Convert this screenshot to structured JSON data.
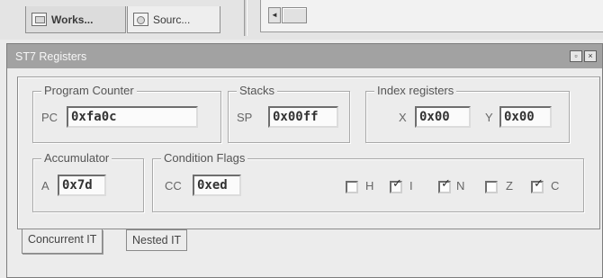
{
  "workspace_tabs": [
    {
      "label": "Works...",
      "icon": "workspace-icon",
      "active": true
    },
    {
      "label": "Sourc...",
      "icon": "source-icon",
      "active": false
    }
  ],
  "scroll_left_glyph": "◄",
  "window": {
    "title": "ST7 Registers",
    "restore_glyph": "▫",
    "close_glyph": "×"
  },
  "program_counter": {
    "group": "Program Counter",
    "label": "PC",
    "value": "0xfa0c"
  },
  "stacks": {
    "group": "Stacks",
    "label": "SP",
    "value": "0x00ff"
  },
  "index_registers": {
    "group": "Index registers",
    "x_label": "X",
    "x_value": "0x00",
    "y_label": "Y",
    "y_value": "0x00"
  },
  "accumulator": {
    "group": "Accumulator",
    "label": "A",
    "value": "0x7d"
  },
  "condition_flags": {
    "group": "Condition Flags",
    "label": "CC",
    "value": "0xed",
    "flags": [
      {
        "name": "H",
        "checked": false
      },
      {
        "name": "I",
        "checked": true
      },
      {
        "name": "N",
        "checked": true
      },
      {
        "name": "Z",
        "checked": false
      },
      {
        "name": "C",
        "checked": true
      }
    ]
  },
  "bottom_tabs": [
    {
      "label": "Concurrent IT",
      "active": true
    },
    {
      "label": "Nested IT",
      "active": false
    }
  ],
  "check_glyph": "✓"
}
